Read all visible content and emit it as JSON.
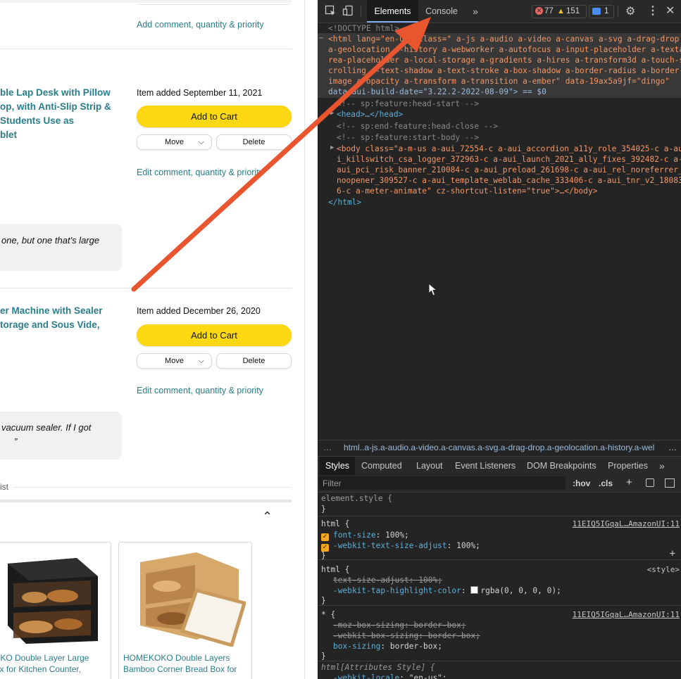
{
  "left_page": {
    "item1": {
      "title_lines": [
        "ble Lap Desk with Pillow",
        "op, with Anti-Slip Strip &",
        "Students Use as",
        "blet"
      ],
      "added": "Item added September 11, 2021",
      "add_to_cart": "Add to Cart",
      "move": "Move",
      "delete": "Delete",
      "edit_link": "Edit comment, quantity & priority"
    },
    "top_edit_link": "Add comment, quantity & priority",
    "note1": "one, but one that's large",
    "item2": {
      "title_lines": [
        "er Machine with Sealer",
        "torage and Sous Vide,"
      ],
      "added": "Item added December 26, 2020",
      "add_to_cart": "Add to Cart",
      "move": "Move",
      "delete": "Delete",
      "edit_link": "Edit comment, quantity & priority"
    },
    "note2_lines": [
      "vacuum sealer. If I got",
      "”"
    ],
    "list_label": "ist",
    "products": [
      {
        "title_lines": [
          "EKOKO Double Layer Large",
          "d Box for Kitchen Counter,"
        ]
      },
      {
        "title_lines": [
          "HOMEKOKO Double Layers",
          "Bamboo Corner Bread Box for"
        ]
      }
    ]
  },
  "devtools": {
    "tabs": [
      "Elements",
      "Console"
    ],
    "more_tabs": "»",
    "errors": "77",
    "warnings": "151",
    "messages": "1",
    "icons": [
      "inspect-icon",
      "device-toggle-icon",
      "gear-icon",
      "kebab-icon",
      "close-icon"
    ],
    "dom_lines": [
      "<!DOCTYPE html>",
      "<html lang=\"en-us\" class=\" a-js a-audio a-video a-canvas a-svg a-drag-drop",
      "a-geolocation a-history a-webworker a-autofocus a-input-placeholder a-texta",
      "rea-placeholder a-local-storage a-gradients a-hires a-transform3d a-touch-s",
      "crolling a-text-shadow a-text-stroke a-box-shadow a-border-radius a-border-",
      "image a-opacity a-transform a-transition a-ember\" data-19ax5a9jf=\"dingo\"",
      "data-aui-build-date=\"3.22.2-2022-08-09\"> == $0",
      "<!-- sp:feature:head-start -->",
      "<head>…</head>",
      "<!-- sp:end-feature:head-close -->",
      "<!-- sp:feature:start-body -->",
      "<body class=\"a-m-us a-aui_72554-c a-aui_accordion_a11y_role_354025-c a-au",
      "i_killswitch_csa_logger_372963-c a-aui_launch_2021_ally_fixes_392482-c a-",
      "aui_pci_risk_banner_210084-c a-aui_preload_261698-c a-aui_rel_noreferrer_",
      "noopener_309527-c a-aui_template_weblab_cache_333406-c a-aui_tnr_v2_18083",
      "6-c a-meter-animate\" cz-shortcut-listen=\"true\">…</body>",
      "</html>"
    ],
    "breadcrumb": "html..a-js.a-audio.a-video.a-canvas.a-svg.a-drag-drop.a-geolocation.a-history.a-wel",
    "breadcrumb_left": "…",
    "breadcrumb_right": "…",
    "styles_tabs": [
      "Styles",
      "Computed",
      "Layout",
      "Event Listeners",
      "DOM Breakpoints",
      "Properties",
      "»"
    ],
    "filter_placeholder": "Filter",
    "hov": ":hov",
    "cls": ".cls",
    "plus": "+",
    "rules": {
      "element_style": "element.style {",
      "close": "}",
      "html1_selector": "html {",
      "html1_source": "11EIQ5IGqaL…AmazonUI:11",
      "html1_props": [
        {
          "name": "font-size",
          "value": "100%;"
        },
        {
          "name": "-webkit-text-size-adjust",
          "value": "100%;"
        }
      ],
      "html2_selector": "html {",
      "html2_source": "<style>",
      "html2_struck": "text-size-adjust: 100%;",
      "html2_prop": "-webkit-tap-highlight-color",
      "html2_value": "rgba(0, 0, 0, 0);",
      "star_selector": "* {",
      "star_source": "11EIQ5IGqaL…AmazonUI:11",
      "star_struck1": "-moz-box-sizing: border-box;",
      "star_struck2": "-webkit-box-sizing: border-box;",
      "star_prop": "box-sizing",
      "star_value": "border-box;",
      "attr_selector": "html[Attributes Style] {",
      "attr_prop": "-webkit-locale",
      "attr_value": "\"en-us\";"
    }
  },
  "colors": {
    "arrow": "#e8552f",
    "add_to_cart": "#ffd814",
    "link": "#2a7e8b",
    "devtools_bg": "#242424"
  }
}
